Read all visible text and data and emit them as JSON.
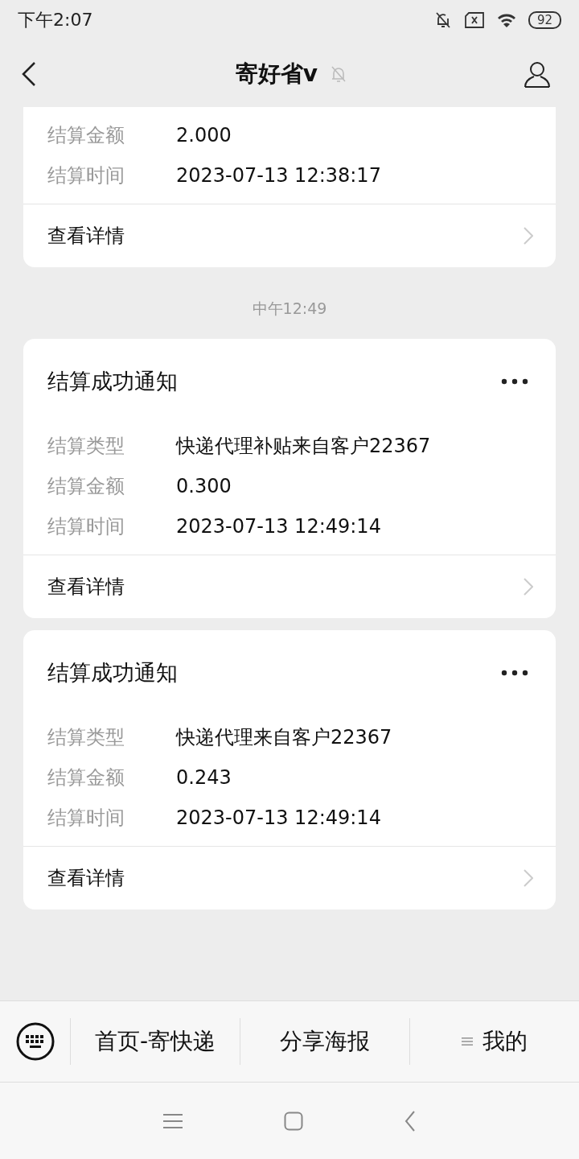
{
  "status_bar": {
    "time": "下午2:07",
    "battery": "92"
  },
  "header": {
    "title": "寄好省v",
    "muted": true
  },
  "feed": [
    {
      "kind": "card",
      "rows": [
        {
          "label": "结算金额",
          "value": "2.000"
        },
        {
          "label": "结算时间",
          "value": "2023-07-13 12:38:17"
        }
      ],
      "link": "查看详情"
    },
    {
      "kind": "time",
      "text": "中午12:49"
    },
    {
      "kind": "card",
      "title": "结算成功通知",
      "rows": [
        {
          "label": "结算类型",
          "value": "快递代理补贴来自客户22367"
        },
        {
          "label": "结算金额",
          "value": "0.300"
        },
        {
          "label": "结算时间",
          "value": "2023-07-13 12:49:14"
        }
      ],
      "link": "查看详情"
    },
    {
      "kind": "card",
      "title": "结算成功通知",
      "rows": [
        {
          "label": "结算类型",
          "value": "快递代理来自客户22367"
        },
        {
          "label": "结算金额",
          "value": "0.243"
        },
        {
          "label": "结算时间",
          "value": "2023-07-13 12:49:14"
        }
      ],
      "link": "查看详情"
    }
  ],
  "menu": [
    {
      "label": "首页-寄快递",
      "submenu": false
    },
    {
      "label": "分享海报",
      "submenu": false
    },
    {
      "label": "我的",
      "submenu": true
    }
  ]
}
